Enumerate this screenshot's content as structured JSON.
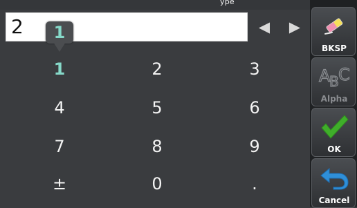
{
  "header": {
    "title_fragment": "ype"
  },
  "input": {
    "value": "2"
  },
  "cursor_controls": {
    "left_arrow": "◀",
    "right_arrow": "▶"
  },
  "keypad": {
    "popup_digit": "1",
    "keys": [
      {
        "label": "1",
        "pressed": true
      },
      {
        "label": "2",
        "pressed": false
      },
      {
        "label": "3",
        "pressed": false
      },
      {
        "label": "4",
        "pressed": false
      },
      {
        "label": "5",
        "pressed": false
      },
      {
        "label": "6",
        "pressed": false
      },
      {
        "label": "7",
        "pressed": false
      },
      {
        "label": "8",
        "pressed": false
      },
      {
        "label": "9",
        "pressed": false
      },
      {
        "label": "±",
        "pressed": false
      },
      {
        "label": "0",
        "pressed": false
      },
      {
        "label": ".",
        "pressed": false
      }
    ]
  },
  "side_buttons": {
    "bksp": {
      "label": "BKSP",
      "icon": "eraser-icon",
      "enabled": true
    },
    "alpha": {
      "label": "Alpha",
      "icon": "abc-icon",
      "enabled": false
    },
    "ok": {
      "label": "OK",
      "icon": "checkmark-icon",
      "enabled": true
    },
    "cancel": {
      "label": "Cancel",
      "icon": "return-arrow-icon",
      "enabled": true
    }
  },
  "colors": {
    "background": "#3a3c3f",
    "pressed_key": "#86d9c9",
    "ok_check": "#3fae2a",
    "cancel_arrow": "#2f8fd8"
  }
}
